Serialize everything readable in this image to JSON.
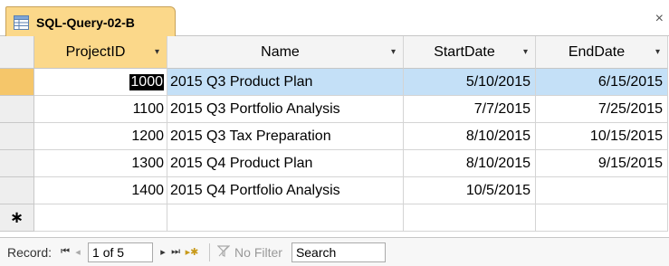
{
  "tab": {
    "title": "SQL-Query-02-B",
    "icon": "datasheet-query-icon",
    "close": "×"
  },
  "columns": [
    {
      "label": "ProjectID",
      "sort_icon": "▾"
    },
    {
      "label": "Name",
      "sort_icon": "▾"
    },
    {
      "label": "StartDate",
      "sort_icon": "▾"
    },
    {
      "label": "EndDate",
      "sort_icon": "▾"
    }
  ],
  "rows": [
    {
      "ProjectID": "1000",
      "Name": "2015 Q3 Product Plan",
      "StartDate": "5/10/2015",
      "EndDate": "6/15/2015"
    },
    {
      "ProjectID": "1100",
      "Name": "2015 Q3 Portfolio Analysis",
      "StartDate": "7/7/2015",
      "EndDate": "7/25/2015"
    },
    {
      "ProjectID": "1200",
      "Name": "2015 Q3 Tax Preparation",
      "StartDate": "8/10/2015",
      "EndDate": "10/15/2015"
    },
    {
      "ProjectID": "1300",
      "Name": "2015 Q4 Product Plan",
      "StartDate": "8/10/2015",
      "EndDate": "9/15/2015"
    },
    {
      "ProjectID": "1400",
      "Name": "2015 Q4 Portfolio Analysis",
      "StartDate": "10/5/2015",
      "EndDate": ""
    }
  ],
  "new_record_marker": "∗",
  "navigator": {
    "label": "Record:",
    "first": "⏮",
    "prev": "◂",
    "position": "1 of 5",
    "next": "▸",
    "last": "⏭",
    "new": "▸✱",
    "filter_label": "No Filter",
    "search_placeholder": "Search"
  },
  "colors": {
    "tab_bg": "#fbd88a",
    "active_row": "#c4e0f7",
    "record_selector_active": "#f5c66a"
  }
}
